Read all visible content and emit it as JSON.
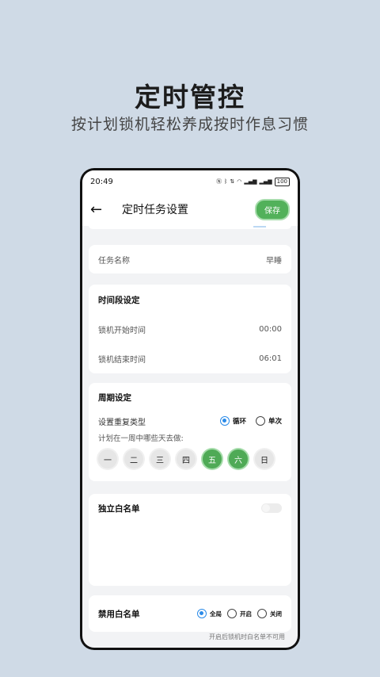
{
  "promo": {
    "title": "定时管控",
    "subtitle": "按计划锁机轻松养成按时作息习惯"
  },
  "status_bar": {
    "time": "20:49",
    "battery": "100"
  },
  "header": {
    "title": "定时任务设置",
    "save_label": "保存"
  },
  "task": {
    "name_label": "任务名称",
    "name_value": "早睡"
  },
  "time_period": {
    "heading": "时间段设定",
    "start_label": "锁机开始时间",
    "start_value": "00:00",
    "end_label": "锁机结束时间",
    "end_value": "06:01"
  },
  "cycle": {
    "heading": "周期设定",
    "repeat_label": "设置重复类型",
    "options": [
      "循环",
      "单次"
    ],
    "selected": "循环",
    "days_prompt": "计划在一周中哪些天去做:",
    "days": [
      {
        "label": "一",
        "selected": false
      },
      {
        "label": "二",
        "selected": false
      },
      {
        "label": "三",
        "selected": false
      },
      {
        "label": "四",
        "selected": false
      },
      {
        "label": "五",
        "selected": true
      },
      {
        "label": "六",
        "selected": true
      },
      {
        "label": "日",
        "selected": false
      }
    ]
  },
  "whitelist": {
    "heading": "独立白名单",
    "enabled": false
  },
  "disable_whitelist": {
    "heading": "禁用白名单",
    "options": [
      "全局",
      "开启",
      "关闭"
    ],
    "selected": "全局",
    "note": "开启后锁机时白名单不可用"
  },
  "colors": {
    "accent_green": "#52b15a",
    "radio_blue": "#2b8be8",
    "background": "#cfdae6"
  }
}
